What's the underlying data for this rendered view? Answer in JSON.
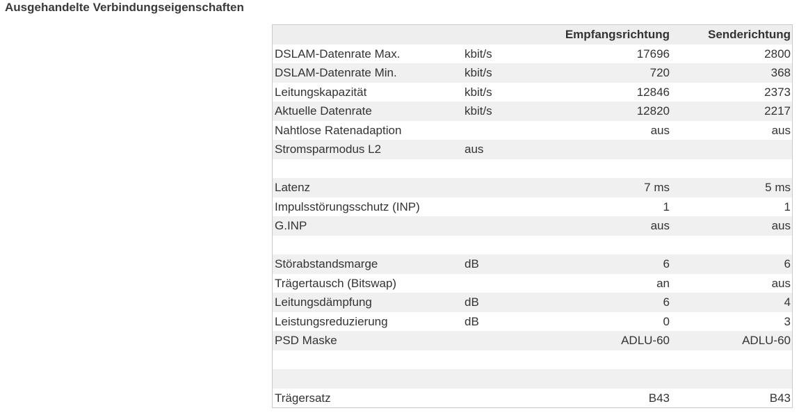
{
  "section": {
    "title": "Ausgehandelte Verbindungseigenschaften"
  },
  "table": {
    "headers": {
      "label": "",
      "unit": "",
      "downstream": "Empfangsrichtung",
      "upstream": "Senderichtung"
    },
    "rows": [
      {
        "label": "DSLAM-Datenrate Max.",
        "unit": "kbit/s",
        "downstream": "17696",
        "upstream": "2800"
      },
      {
        "label": "DSLAM-Datenrate Min.",
        "unit": "kbit/s",
        "downstream": "720",
        "upstream": "368"
      },
      {
        "label": "Leitungskapazität",
        "unit": "kbit/s",
        "downstream": "12846",
        "upstream": "2373"
      },
      {
        "label": "Aktuelle Datenrate",
        "unit": "kbit/s",
        "downstream": "12820",
        "upstream": "2217"
      },
      {
        "label": "Nahtlose Ratenadaption",
        "unit": "",
        "downstream": "aus",
        "upstream": "aus"
      },
      {
        "label": "Stromsparmodus L2",
        "unit": "aus",
        "downstream": "",
        "upstream": ""
      },
      {
        "label": "",
        "unit": "",
        "downstream": "",
        "upstream": ""
      },
      {
        "label": "Latenz",
        "unit": "",
        "downstream": "7 ms",
        "upstream": "5 ms"
      },
      {
        "label": "Impulsstörungsschutz (INP)",
        "unit": "",
        "downstream": "1",
        "upstream": "1"
      },
      {
        "label": "G.INP",
        "unit": "",
        "downstream": "aus",
        "upstream": "aus"
      },
      {
        "label": "",
        "unit": "",
        "downstream": "",
        "upstream": ""
      },
      {
        "label": "Störabstandsmarge",
        "unit": "dB",
        "downstream": "6",
        "upstream": "6"
      },
      {
        "label": "Trägertausch (Bitswap)",
        "unit": "",
        "downstream": "an",
        "upstream": "aus"
      },
      {
        "label": "Leitungsdämpfung",
        "unit": "dB",
        "downstream": "6",
        "upstream": "4"
      },
      {
        "label": "Leistungsreduzierung",
        "unit": "dB",
        "downstream": "0",
        "upstream": "3"
      },
      {
        "label": "PSD Maske",
        "unit": "",
        "downstream": "ADLU-60",
        "upstream": "ADLU-60"
      },
      {
        "label": "",
        "unit": "",
        "downstream": "",
        "upstream": ""
      },
      {
        "label": "",
        "unit": "",
        "downstream": "",
        "upstream": ""
      },
      {
        "label": "Trägersatz",
        "unit": "",
        "downstream": "B43",
        "upstream": "B43"
      }
    ]
  }
}
